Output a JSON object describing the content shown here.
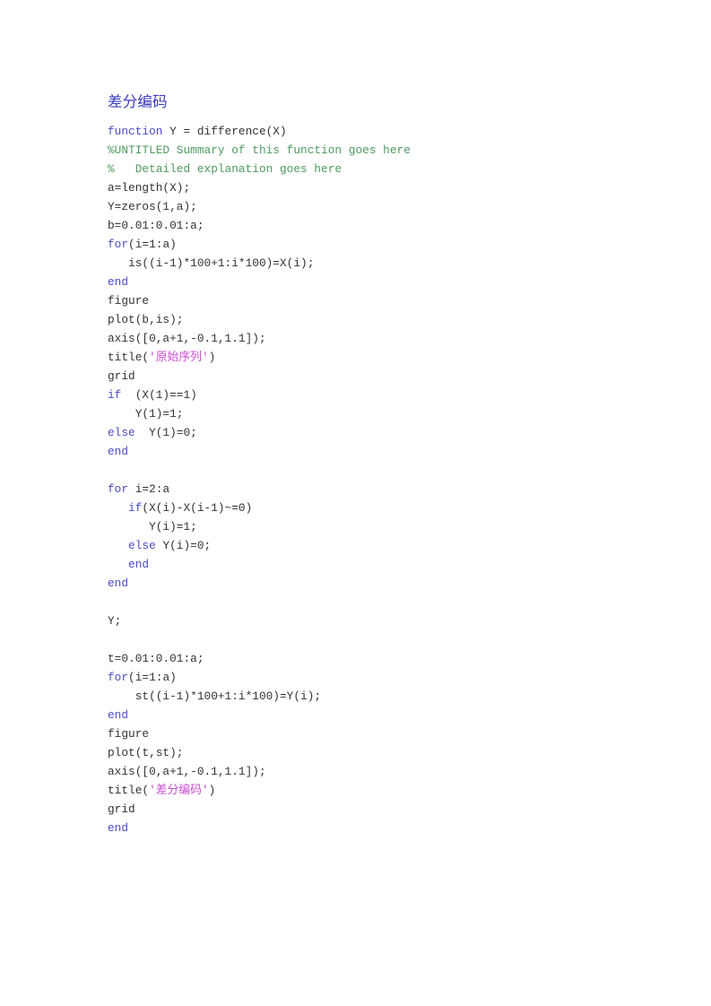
{
  "document": {
    "heading": "差分编码",
    "language": "matlab",
    "colors": {
      "background": "#ffffff",
      "heading": "#3b3bbd",
      "keyword": "#4b4bc8",
      "comment": "#4f9a5e",
      "string": "#c94fd0",
      "plain": "#333333"
    },
    "code_lines": [
      {
        "text": "function Y = difference(X)",
        "type": "mixed",
        "spans": [
          {
            "t": "function",
            "c": "keyword"
          },
          {
            "t": " Y = difference(X)",
            "c": "plain"
          }
        ]
      },
      {
        "text": "%UNTITLED Summary of this function goes here",
        "type": "comment",
        "spans": [
          {
            "t": "%UNTITLED Summary of this function goes here",
            "c": "comment"
          }
        ]
      },
      {
        "text": "%   Detailed explanation goes here",
        "type": "comment",
        "spans": [
          {
            "t": "%   Detailed explanation goes here",
            "c": "comment"
          }
        ]
      },
      {
        "text": "a=length(X);",
        "type": "plain",
        "spans": [
          {
            "t": "a=length(X);",
            "c": "plain"
          }
        ]
      },
      {
        "text": "Y=zeros(1,a);",
        "type": "plain",
        "spans": [
          {
            "t": "Y=zeros(1,a);",
            "c": "plain"
          }
        ]
      },
      {
        "text": "b=0.01:0.01:a;",
        "type": "plain",
        "spans": [
          {
            "t": "b=0.01:0.01:a;",
            "c": "plain"
          }
        ]
      },
      {
        "text": "for(i=1:a)",
        "type": "mixed",
        "spans": [
          {
            "t": "for",
            "c": "keyword"
          },
          {
            "t": "(i=1:a)",
            "c": "plain"
          }
        ]
      },
      {
        "text": "   is((i-1)*100+1:i*100)=X(i);",
        "type": "plain",
        "spans": [
          {
            "t": "   is((i-1)*100+1:i*100)=X(i);",
            "c": "plain"
          }
        ]
      },
      {
        "text": "end",
        "type": "keyword",
        "spans": [
          {
            "t": "end",
            "c": "keyword"
          }
        ]
      },
      {
        "text": "figure",
        "type": "plain",
        "spans": [
          {
            "t": "figure",
            "c": "plain"
          }
        ]
      },
      {
        "text": "plot(b,is);",
        "type": "plain",
        "spans": [
          {
            "t": "plot(b,is);",
            "c": "plain"
          }
        ]
      },
      {
        "text": "axis([0,a+1,-0.1,1.1]);",
        "type": "plain",
        "spans": [
          {
            "t": "axis([0,a+1,-0.1,1.1]);",
            "c": "plain"
          }
        ]
      },
      {
        "text": "title('原始序列')",
        "type": "mixed",
        "spans": [
          {
            "t": "title(",
            "c": "plain"
          },
          {
            "t": "'原始序列'",
            "c": "string"
          },
          {
            "t": ")",
            "c": "plain"
          }
        ]
      },
      {
        "text": "grid",
        "type": "plain",
        "spans": [
          {
            "t": "grid",
            "c": "plain"
          }
        ]
      },
      {
        "text": "if  (X(1)==1)",
        "type": "mixed",
        "spans": [
          {
            "t": "if",
            "c": "keyword"
          },
          {
            "t": "  (X(1)==1)",
            "c": "plain"
          }
        ]
      },
      {
        "text": "    Y(1)=1;",
        "type": "plain",
        "spans": [
          {
            "t": "    Y(1)=1;",
            "c": "plain"
          }
        ]
      },
      {
        "text": "else  Y(1)=0;",
        "type": "mixed",
        "spans": [
          {
            "t": "else",
            "c": "keyword"
          },
          {
            "t": "  Y(1)=0;",
            "c": "plain"
          }
        ]
      },
      {
        "text": "end",
        "type": "keyword",
        "spans": [
          {
            "t": "end",
            "c": "keyword"
          }
        ]
      },
      {
        "text": "",
        "type": "blank",
        "spans": []
      },
      {
        "text": "for i=2:a",
        "type": "mixed",
        "spans": [
          {
            "t": "for",
            "c": "keyword"
          },
          {
            "t": " i=2:a",
            "c": "plain"
          }
        ]
      },
      {
        "text": "   if(X(i)-X(i-1)~=0)",
        "type": "mixed",
        "spans": [
          {
            "t": "   ",
            "c": "plain"
          },
          {
            "t": "if",
            "c": "keyword"
          },
          {
            "t": "(X(i)-X(i-1)~=0)",
            "c": "plain"
          }
        ]
      },
      {
        "text": "      Y(i)=1;",
        "type": "plain",
        "spans": [
          {
            "t": "      Y(i)=1;",
            "c": "plain"
          }
        ]
      },
      {
        "text": "   else Y(i)=0;",
        "type": "mixed",
        "spans": [
          {
            "t": "   ",
            "c": "plain"
          },
          {
            "t": "else",
            "c": "keyword"
          },
          {
            "t": " Y(i)=0;",
            "c": "plain"
          }
        ]
      },
      {
        "text": "   end",
        "type": "mixed",
        "spans": [
          {
            "t": "   ",
            "c": "plain"
          },
          {
            "t": "end",
            "c": "keyword"
          }
        ]
      },
      {
        "text": "end",
        "type": "keyword",
        "spans": [
          {
            "t": "end",
            "c": "keyword"
          }
        ]
      },
      {
        "text": "",
        "type": "blank",
        "spans": []
      },
      {
        "text": "Y;",
        "type": "plain",
        "spans": [
          {
            "t": "Y;",
            "c": "plain"
          }
        ]
      },
      {
        "text": "",
        "type": "blank",
        "spans": []
      },
      {
        "text": "t=0.01:0.01:a;",
        "type": "plain",
        "spans": [
          {
            "t": "t=0.01:0.01:a;",
            "c": "plain"
          }
        ]
      },
      {
        "text": "for(i=1:a)",
        "type": "mixed",
        "spans": [
          {
            "t": "for",
            "c": "keyword"
          },
          {
            "t": "(i=1:a)",
            "c": "plain"
          }
        ]
      },
      {
        "text": "    st((i-1)*100+1:i*100)=Y(i);",
        "type": "plain",
        "spans": [
          {
            "t": "    st((i-1)*100+1:i*100)=Y(i);",
            "c": "plain"
          }
        ]
      },
      {
        "text": "end",
        "type": "keyword",
        "spans": [
          {
            "t": "end",
            "c": "keyword"
          }
        ]
      },
      {
        "text": "figure",
        "type": "plain",
        "spans": [
          {
            "t": "figure",
            "c": "plain"
          }
        ]
      },
      {
        "text": "plot(t,st);",
        "type": "plain",
        "spans": [
          {
            "t": "plot(t,st);",
            "c": "plain"
          }
        ]
      },
      {
        "text": "axis([0,a+1,-0.1,1.1]);",
        "type": "plain",
        "spans": [
          {
            "t": "axis([0,a+1,-0.1,1.1]);",
            "c": "plain"
          }
        ]
      },
      {
        "text": "title('差分编码')",
        "type": "mixed",
        "spans": [
          {
            "t": "title(",
            "c": "plain"
          },
          {
            "t": "'差分编码'",
            "c": "string"
          },
          {
            "t": ")",
            "c": "plain"
          }
        ]
      },
      {
        "text": "grid",
        "type": "plain",
        "spans": [
          {
            "t": "grid",
            "c": "plain"
          }
        ]
      },
      {
        "text": "end",
        "type": "keyword",
        "spans": [
          {
            "t": "end",
            "c": "keyword"
          }
        ]
      }
    ]
  }
}
